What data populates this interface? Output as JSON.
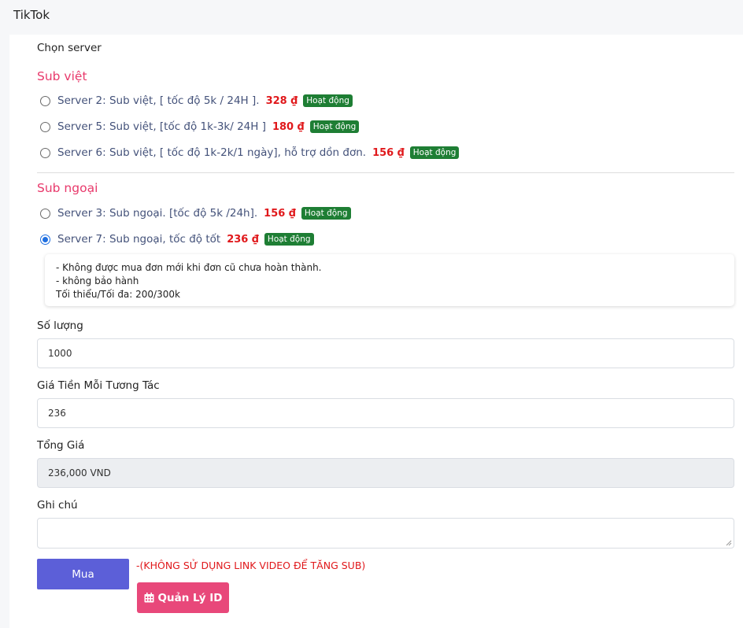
{
  "header": {
    "title": "TikTok"
  },
  "form": {
    "server_label": "Chọn server",
    "groups": [
      {
        "title": "Sub việt",
        "servers": [
          {
            "text": "Server 2: Sub việt, [ tốc độ 5k / 24H ].",
            "price": "328 ₫",
            "status": "Hoạt động",
            "selected": false
          },
          {
            "text": "Server 5: Sub việt, [tốc độ 1k-3k/ 24H ]",
            "price": "180 ₫",
            "status": "Hoạt động",
            "selected": false
          },
          {
            "text": "Server 6: Sub việt, [ tốc độ 1k-2k/1 ngày], hỗ trợ dồn đơn.",
            "price": "156 ₫",
            "status": "Hoạt động",
            "selected": false
          }
        ]
      },
      {
        "title": "Sub ngoại",
        "servers": [
          {
            "text": "Server 3: Sub ngoại. [tốc độ 5k /24h].",
            "price": "156 ₫",
            "status": "Hoạt động",
            "selected": false
          },
          {
            "text": "Server 7: Sub ngoại, tốc độ tốt",
            "price": "236 ₫",
            "status": "Hoạt động",
            "selected": true
          }
        ]
      }
    ],
    "notes": [
      "- Không được mua đơn mới khi đơn cũ chưa hoàn thành.",
      "- không bảo hành",
      "Tối thiểu/Tối đa: 200/300k"
    ],
    "quantity_label": "Số lượng",
    "quantity_value": "1000",
    "unit_price_label": "Giá Tiền Mỗi Tương Tác",
    "unit_price_value": "236",
    "total_label": "Tổng Giá",
    "total_value": "236,000 VND",
    "note_label": "Ghi chú",
    "note_value": "",
    "buy_label": "Mua",
    "warning": "-(KHÔNG SỬ DỤNG LINK VIDEO ĐỂ TĂNG SUB)",
    "manage_label": "Quản Lý ID",
    "manage_icon": "calendar-icon"
  },
  "colors": {
    "accent_pink": "#e8396b",
    "price_red": "#e0181b",
    "badge_green": "#1e7e34",
    "buy_button": "#5c5fd8",
    "manage_button": "#e8487a"
  }
}
